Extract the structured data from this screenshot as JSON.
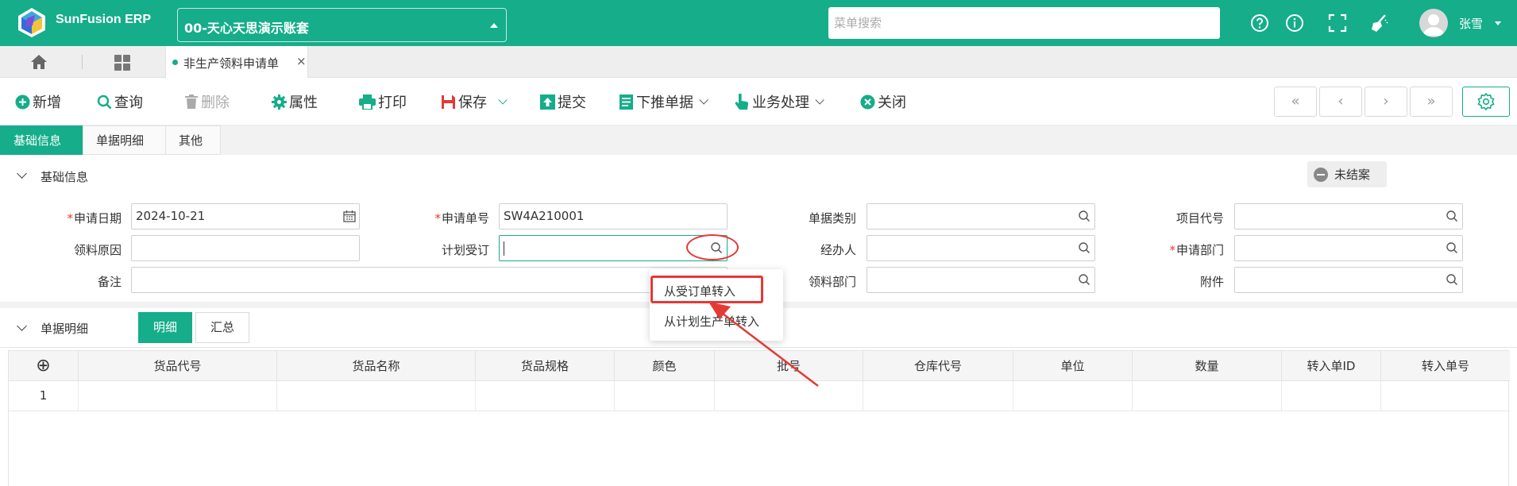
{
  "header": {
    "brand": "SunFusion ERP",
    "company": "00-天心天思演示账套",
    "search_placeholder": "菜单搜索",
    "user_name": "张雪",
    "icons": [
      "help-icon",
      "info-icon",
      "fullscreen-icon",
      "clean-icon"
    ]
  },
  "tabbar": {
    "open_tab": "非生产领料申请单",
    "close_glyph": "×"
  },
  "toolbar": {
    "new": "新增",
    "query": "查询",
    "delete": "删除",
    "properties": "属性",
    "print": "打印",
    "save": "保存",
    "submit": "提交",
    "push_down": "下推单据",
    "business": "业务处理",
    "close": "关闭",
    "nav": [
      "«",
      "‹",
      "›",
      "»"
    ]
  },
  "section_tabs": [
    "基础信息",
    "单据明细",
    "其他"
  ],
  "basic_info": {
    "title": "基础信息",
    "status": "未结案",
    "fields": {
      "apply_date": {
        "label": "申请日期",
        "value": "2024-10-21",
        "required": true
      },
      "apply_no": {
        "label": "申请单号",
        "value": "SW4A210001",
        "required": true
      },
      "doc_type": {
        "label": "单据类别",
        "value": ""
      },
      "project_code": {
        "label": "项目代号",
        "value": ""
      },
      "reason": {
        "label": "领料原因",
        "value": ""
      },
      "plan_order": {
        "label": "计划受订",
        "value": ""
      },
      "handler": {
        "label": "经办人",
        "value": ""
      },
      "apply_dept": {
        "label": "申请部门",
        "value": "",
        "required": true
      },
      "remark": {
        "label": "备注",
        "value": ""
      },
      "pick_dept": {
        "label": "领料部门",
        "value": ""
      },
      "attachment": {
        "label": "附件",
        "value": ""
      }
    },
    "required_mark": "*"
  },
  "popup": {
    "items": [
      "从受订单转入",
      "从计划生产单转入"
    ]
  },
  "detail": {
    "title": "单据明细",
    "view_tabs": [
      "明细",
      "汇总"
    ],
    "add_glyph": "⊕",
    "columns": [
      "货品代号",
      "货品名称",
      "货品规格",
      "颜色",
      "批号",
      "仓库代号",
      "单位",
      "数量",
      "转入单ID",
      "转入单号"
    ],
    "rows": [
      {
        "index": "1"
      }
    ]
  },
  "colors": {
    "brand": "#15ad8a",
    "annotation": "#e53935"
  }
}
